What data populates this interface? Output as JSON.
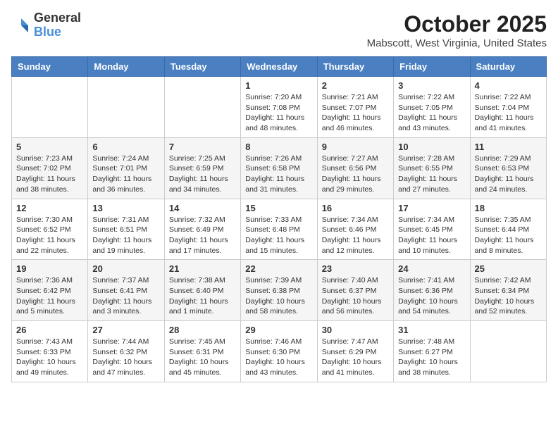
{
  "logo": {
    "general": "General",
    "blue": "Blue"
  },
  "header": {
    "month": "October 2025",
    "location": "Mabscott, West Virginia, United States"
  },
  "weekdays": [
    "Sunday",
    "Monday",
    "Tuesday",
    "Wednesday",
    "Thursday",
    "Friday",
    "Saturday"
  ],
  "weeks": [
    [
      {
        "day": "",
        "info": ""
      },
      {
        "day": "",
        "info": ""
      },
      {
        "day": "",
        "info": ""
      },
      {
        "day": "1",
        "info": "Sunrise: 7:20 AM\nSunset: 7:08 PM\nDaylight: 11 hours\nand 48 minutes."
      },
      {
        "day": "2",
        "info": "Sunrise: 7:21 AM\nSunset: 7:07 PM\nDaylight: 11 hours\nand 46 minutes."
      },
      {
        "day": "3",
        "info": "Sunrise: 7:22 AM\nSunset: 7:05 PM\nDaylight: 11 hours\nand 43 minutes."
      },
      {
        "day": "4",
        "info": "Sunrise: 7:22 AM\nSunset: 7:04 PM\nDaylight: 11 hours\nand 41 minutes."
      }
    ],
    [
      {
        "day": "5",
        "info": "Sunrise: 7:23 AM\nSunset: 7:02 PM\nDaylight: 11 hours\nand 38 minutes."
      },
      {
        "day": "6",
        "info": "Sunrise: 7:24 AM\nSunset: 7:01 PM\nDaylight: 11 hours\nand 36 minutes."
      },
      {
        "day": "7",
        "info": "Sunrise: 7:25 AM\nSunset: 6:59 PM\nDaylight: 11 hours\nand 34 minutes."
      },
      {
        "day": "8",
        "info": "Sunrise: 7:26 AM\nSunset: 6:58 PM\nDaylight: 11 hours\nand 31 minutes."
      },
      {
        "day": "9",
        "info": "Sunrise: 7:27 AM\nSunset: 6:56 PM\nDaylight: 11 hours\nand 29 minutes."
      },
      {
        "day": "10",
        "info": "Sunrise: 7:28 AM\nSunset: 6:55 PM\nDaylight: 11 hours\nand 27 minutes."
      },
      {
        "day": "11",
        "info": "Sunrise: 7:29 AM\nSunset: 6:53 PM\nDaylight: 11 hours\nand 24 minutes."
      }
    ],
    [
      {
        "day": "12",
        "info": "Sunrise: 7:30 AM\nSunset: 6:52 PM\nDaylight: 11 hours\nand 22 minutes."
      },
      {
        "day": "13",
        "info": "Sunrise: 7:31 AM\nSunset: 6:51 PM\nDaylight: 11 hours\nand 19 minutes."
      },
      {
        "day": "14",
        "info": "Sunrise: 7:32 AM\nSunset: 6:49 PM\nDaylight: 11 hours\nand 17 minutes."
      },
      {
        "day": "15",
        "info": "Sunrise: 7:33 AM\nSunset: 6:48 PM\nDaylight: 11 hours\nand 15 minutes."
      },
      {
        "day": "16",
        "info": "Sunrise: 7:34 AM\nSunset: 6:46 PM\nDaylight: 11 hours\nand 12 minutes."
      },
      {
        "day": "17",
        "info": "Sunrise: 7:34 AM\nSunset: 6:45 PM\nDaylight: 11 hours\nand 10 minutes."
      },
      {
        "day": "18",
        "info": "Sunrise: 7:35 AM\nSunset: 6:44 PM\nDaylight: 11 hours\nand 8 minutes."
      }
    ],
    [
      {
        "day": "19",
        "info": "Sunrise: 7:36 AM\nSunset: 6:42 PM\nDaylight: 11 hours\nand 5 minutes."
      },
      {
        "day": "20",
        "info": "Sunrise: 7:37 AM\nSunset: 6:41 PM\nDaylight: 11 hours\nand 3 minutes."
      },
      {
        "day": "21",
        "info": "Sunrise: 7:38 AM\nSunset: 6:40 PM\nDaylight: 11 hours\nand 1 minute."
      },
      {
        "day": "22",
        "info": "Sunrise: 7:39 AM\nSunset: 6:38 PM\nDaylight: 10 hours\nand 58 minutes."
      },
      {
        "day": "23",
        "info": "Sunrise: 7:40 AM\nSunset: 6:37 PM\nDaylight: 10 hours\nand 56 minutes."
      },
      {
        "day": "24",
        "info": "Sunrise: 7:41 AM\nSunset: 6:36 PM\nDaylight: 10 hours\nand 54 minutes."
      },
      {
        "day": "25",
        "info": "Sunrise: 7:42 AM\nSunset: 6:34 PM\nDaylight: 10 hours\nand 52 minutes."
      }
    ],
    [
      {
        "day": "26",
        "info": "Sunrise: 7:43 AM\nSunset: 6:33 PM\nDaylight: 10 hours\nand 49 minutes."
      },
      {
        "day": "27",
        "info": "Sunrise: 7:44 AM\nSunset: 6:32 PM\nDaylight: 10 hours\nand 47 minutes."
      },
      {
        "day": "28",
        "info": "Sunrise: 7:45 AM\nSunset: 6:31 PM\nDaylight: 10 hours\nand 45 minutes."
      },
      {
        "day": "29",
        "info": "Sunrise: 7:46 AM\nSunset: 6:30 PM\nDaylight: 10 hours\nand 43 minutes."
      },
      {
        "day": "30",
        "info": "Sunrise: 7:47 AM\nSunset: 6:29 PM\nDaylight: 10 hours\nand 41 minutes."
      },
      {
        "day": "31",
        "info": "Sunrise: 7:48 AM\nSunset: 6:27 PM\nDaylight: 10 hours\nand 38 minutes."
      },
      {
        "day": "",
        "info": ""
      }
    ]
  ]
}
